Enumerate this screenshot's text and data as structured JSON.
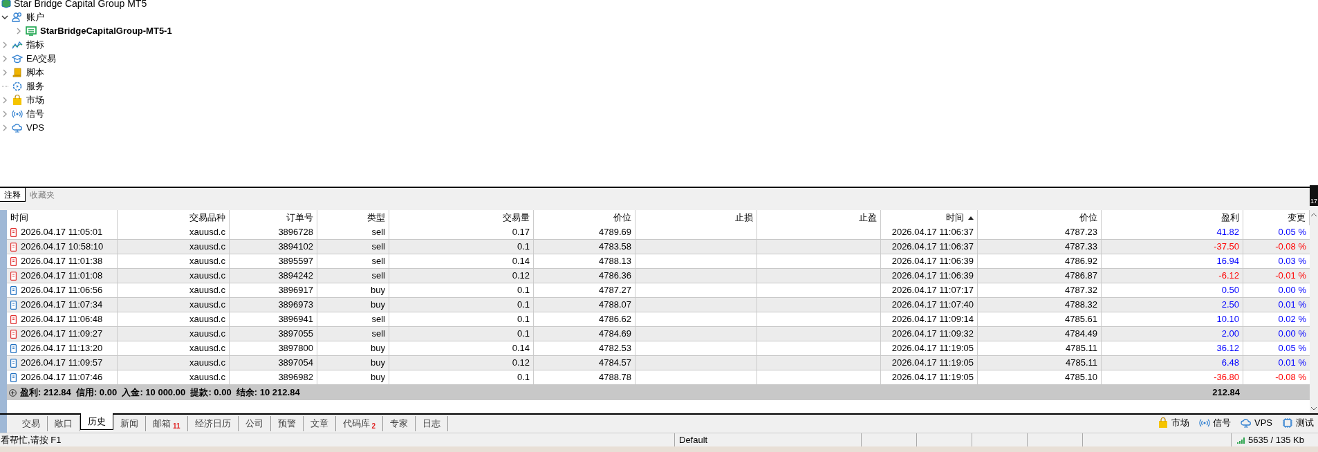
{
  "navigator": {
    "title": "Star Bridge Capital Group MT5",
    "items": [
      {
        "label": "账户",
        "kind": "accounts",
        "expandable": true,
        "expanded": true,
        "children": [
          {
            "label": "StarBridgeCapitalGroup-MT5-1",
            "kind": "server",
            "expandable": true,
            "expanded": false
          }
        ]
      },
      {
        "label": "指标",
        "kind": "indicators",
        "expandable": true,
        "expanded": false
      },
      {
        "label": "EA交易",
        "kind": "experts",
        "expandable": true,
        "expanded": false
      },
      {
        "label": "脚本",
        "kind": "scripts",
        "expandable": true,
        "expanded": false
      },
      {
        "label": "服务",
        "kind": "services",
        "expandable": false
      },
      {
        "label": "市场",
        "kind": "market",
        "expandable": true,
        "expanded": false
      },
      {
        "label": "信号",
        "kind": "signals",
        "expandable": true,
        "expanded": false
      },
      {
        "label": "VPS",
        "kind": "vps",
        "expandable": true,
        "expanded": false
      }
    ]
  },
  "upper_tabs": [
    {
      "label": "注释",
      "selected": true
    },
    {
      "label": "收藏夹",
      "selected": false
    }
  ],
  "side_strip": {
    "label": "17"
  },
  "table": {
    "columns": [
      {
        "label": "时间",
        "sorted": false
      },
      {
        "label": "交易品种",
        "sorted": false
      },
      {
        "label": "订单号",
        "sorted": false
      },
      {
        "label": "类型",
        "sorted": false
      },
      {
        "label": "交易量",
        "sorted": false
      },
      {
        "label": "价位",
        "sorted": false
      },
      {
        "label": "止损",
        "sorted": false
      },
      {
        "label": "止盈",
        "sorted": false
      },
      {
        "label": "时间",
        "sorted": true
      },
      {
        "label": "价位",
        "sorted": false
      },
      {
        "label": "盈利",
        "sorted": false
      },
      {
        "label": "变更",
        "sorted": false
      }
    ],
    "rows": [
      {
        "kind": "sell",
        "open_time": "2026.04.17 11:05:01",
        "symbol": "xauusd.c",
        "order": "3896728",
        "type": "sell",
        "volume": "0.17",
        "open_price": "4789.69",
        "close_time": "2026.04.17 11:06:37",
        "close_price": "4787.23",
        "profit": "41.82",
        "change": "0.05 %",
        "negative": false
      },
      {
        "kind": "sell",
        "open_time": "2026.04.17 10:58:10",
        "symbol": "xauusd.c",
        "order": "3894102",
        "type": "sell",
        "volume": "0.1",
        "open_price": "4783.58",
        "close_time": "2026.04.17 11:06:37",
        "close_price": "4787.33",
        "profit": "-37.50",
        "change": "-0.08 %",
        "negative": true
      },
      {
        "kind": "sell",
        "open_time": "2026.04.17 11:01:38",
        "symbol": "xauusd.c",
        "order": "3895597",
        "type": "sell",
        "volume": "0.14",
        "open_price": "4788.13",
        "close_time": "2026.04.17 11:06:39",
        "close_price": "4786.92",
        "profit": "16.94",
        "change": "0.03 %",
        "negative": false
      },
      {
        "kind": "sell",
        "open_time": "2026.04.17 11:01:08",
        "symbol": "xauusd.c",
        "order": "3894242",
        "type": "sell",
        "volume": "0.12",
        "open_price": "4786.36",
        "close_time": "2026.04.17 11:06:39",
        "close_price": "4786.87",
        "profit": "-6.12",
        "change": "-0.01 %",
        "negative": true
      },
      {
        "kind": "buy",
        "open_time": "2026.04.17 11:06:56",
        "symbol": "xauusd.c",
        "order": "3896917",
        "type": "buy",
        "volume": "0.1",
        "open_price": "4787.27",
        "close_time": "2026.04.17 11:07:17",
        "close_price": "4787.32",
        "profit": "0.50",
        "change": "0.00 %",
        "negative": false
      },
      {
        "kind": "buy",
        "open_time": "2026.04.17 11:07:34",
        "symbol": "xauusd.c",
        "order": "3896973",
        "type": "buy",
        "volume": "0.1",
        "open_price": "4788.07",
        "close_time": "2026.04.17 11:07:40",
        "close_price": "4788.32",
        "profit": "2.50",
        "change": "0.01 %",
        "negative": false
      },
      {
        "kind": "sell",
        "open_time": "2026.04.17 11:06:48",
        "symbol": "xauusd.c",
        "order": "3896941",
        "type": "sell",
        "volume": "0.1",
        "open_price": "4786.62",
        "close_time": "2026.04.17 11:09:14",
        "close_price": "4785.61",
        "profit": "10.10",
        "change": "0.02 %",
        "negative": false
      },
      {
        "kind": "sell",
        "open_time": "2026.04.17 11:09:27",
        "symbol": "xauusd.c",
        "order": "3897055",
        "type": "sell",
        "volume": "0.1",
        "open_price": "4784.69",
        "close_time": "2026.04.17 11:09:32",
        "close_price": "4784.49",
        "profit": "2.00",
        "change": "0.00 %",
        "negative": false
      },
      {
        "kind": "buy",
        "open_time": "2026.04.17 11:13:20",
        "symbol": "xauusd.c",
        "order": "3897800",
        "type": "buy",
        "volume": "0.14",
        "open_price": "4782.53",
        "close_time": "2026.04.17 11:19:05",
        "close_price": "4785.11",
        "profit": "36.12",
        "change": "0.05 %",
        "negative": false
      },
      {
        "kind": "buy",
        "open_time": "2026.04.17 11:09:57",
        "symbol": "xauusd.c",
        "order": "3897054",
        "type": "buy",
        "volume": "0.12",
        "open_price": "4784.57",
        "close_time": "2026.04.17 11:19:05",
        "close_price": "4785.11",
        "profit": "6.48",
        "change": "0.01 %",
        "negative": false
      },
      {
        "kind": "buy",
        "open_time": "2026.04.17 11:07:46",
        "symbol": "xauusd.c",
        "order": "3896982",
        "type": "buy",
        "volume": "0.1",
        "open_price": "4788.78",
        "close_time": "2026.04.17 11:19:05",
        "close_price": "4785.10",
        "profit": "-36.80",
        "change": "-0.08 %",
        "negative": true
      }
    ],
    "summary": {
      "text": "盈利: 212.84  信用: 0.00  入金: 10 000.00  提款: 0.00  结余: 10 212.84",
      "total": "212.84"
    }
  },
  "bottom_tabs": [
    {
      "label": "交易",
      "selected": false
    },
    {
      "label": "敞口",
      "selected": false
    },
    {
      "label": "历史",
      "selected": true
    },
    {
      "label": "新闻",
      "selected": false
    },
    {
      "label": "邮箱",
      "selected": false,
      "badge": "11"
    },
    {
      "label": "经济日历",
      "selected": false
    },
    {
      "label": "公司",
      "selected": false
    },
    {
      "label": "预警",
      "selected": false
    },
    {
      "label": "文章",
      "selected": false
    },
    {
      "label": "代码库",
      "selected": false,
      "badge": "2"
    },
    {
      "label": "专家",
      "selected": false
    },
    {
      "label": "日志",
      "selected": false
    }
  ],
  "quick_buttons": [
    {
      "label": "市场",
      "kind": "market"
    },
    {
      "label": "信号",
      "kind": "signals"
    },
    {
      "label": "VPS",
      "kind": "vps"
    },
    {
      "label": "测试",
      "kind": "tester"
    }
  ],
  "status_bar": {
    "help": "看帮忙,请按 F1",
    "profile": "Default",
    "traffic": "5635 / 135 Kb"
  }
}
